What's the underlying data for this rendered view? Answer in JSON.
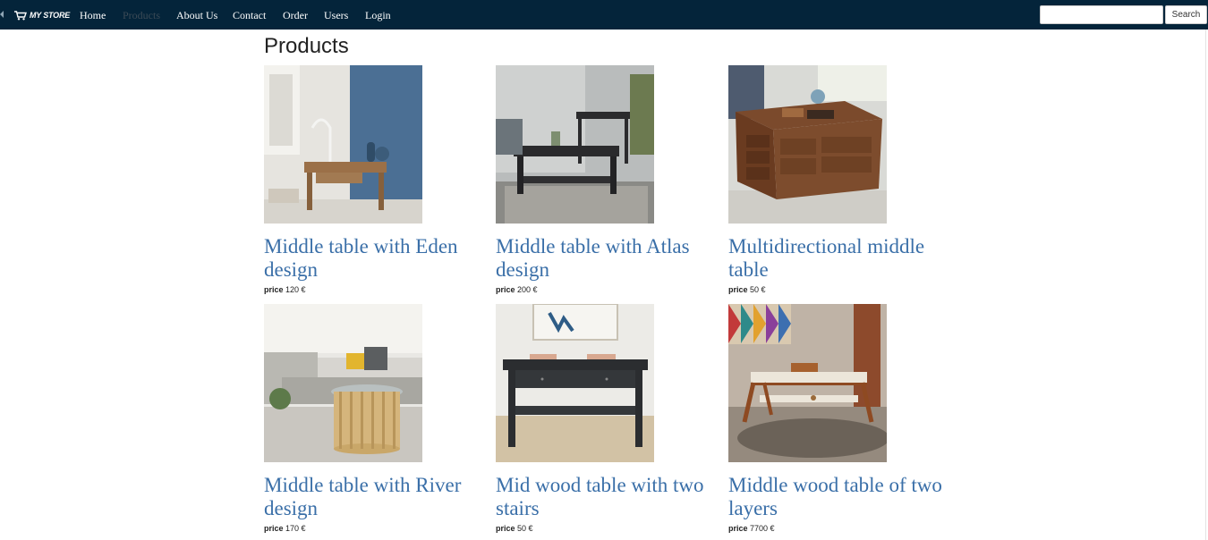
{
  "navbar": {
    "brand": "MY STORE",
    "brand_icon": "cart-icon",
    "items": [
      {
        "label": "Home",
        "active": false
      },
      {
        "label": "Products",
        "active": true
      },
      {
        "label": "About Us",
        "active": false
      },
      {
        "label": "Contact",
        "active": false
      },
      {
        "label": "Order",
        "active": false
      },
      {
        "label": "Users",
        "active": false
      },
      {
        "label": "Login",
        "active": false
      }
    ],
    "search_value": "",
    "search_button": "Search",
    "background": "#04243a"
  },
  "page_title": "Products",
  "link_color": "#3a6fa8",
  "price_label": "price",
  "products": [
    {
      "title": "Middle table with Eden design",
      "price": "120 €"
    },
    {
      "title": "Middle table with Atlas design",
      "price": "200 €"
    },
    {
      "title": "Multidirectional middle table",
      "price": "50 €"
    },
    {
      "title": "Middle table with River design",
      "price": "170 €"
    },
    {
      "title": "Mid wood table with two stairs",
      "price": "50 €"
    },
    {
      "title": "Middle wood table of two layers",
      "price": "7700 €"
    }
  ]
}
